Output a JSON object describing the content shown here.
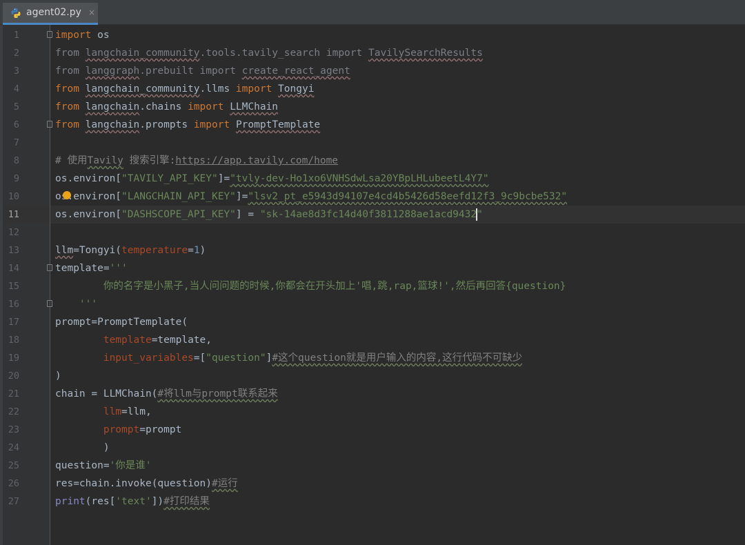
{
  "tab": {
    "filename": "agent02.py",
    "close_glyph": "×"
  },
  "editor": {
    "current_line": 11,
    "lines": [
      {
        "n": "1"
      },
      {
        "n": "2"
      },
      {
        "n": "3"
      },
      {
        "n": "4"
      },
      {
        "n": "5"
      },
      {
        "n": "6"
      },
      {
        "n": "7"
      },
      {
        "n": "8"
      },
      {
        "n": "9"
      },
      {
        "n": "10"
      },
      {
        "n": "11"
      },
      {
        "n": "12"
      },
      {
        "n": "13"
      },
      {
        "n": "14"
      },
      {
        "n": "15"
      },
      {
        "n": "16"
      },
      {
        "n": "17"
      },
      {
        "n": "18"
      },
      {
        "n": "19"
      },
      {
        "n": "20"
      },
      {
        "n": "21"
      },
      {
        "n": "22"
      },
      {
        "n": "23"
      },
      {
        "n": "24"
      },
      {
        "n": "25"
      },
      {
        "n": "26"
      },
      {
        "n": "27"
      }
    ],
    "code": {
      "l1": {
        "kw": "import",
        "rest": " os"
      },
      "l2": {
        "kw1": "from",
        "mod": "langchain_community",
        "mid": ".tools.tavily_search ",
        "kw2": "import",
        "name": "TavilySearchResults"
      },
      "l3": {
        "kw1": "from",
        "mod": "langgraph",
        "mid": ".prebuilt ",
        "kw2": "import",
        "name": "create_react_agent"
      },
      "l4": {
        "kw1": "from",
        "mod": "langchain_community",
        "mid": ".llms ",
        "kw2": "import",
        "name": "Tongyi"
      },
      "l5": {
        "kw1": "from",
        "mod": "langchain",
        "mid": ".chains ",
        "kw2": "import",
        "name": "LLMChain"
      },
      "l6": {
        "kw1": "from",
        "mod": "langchain",
        "mid": ".prompts ",
        "kw2": "import",
        "name": "PromptTemplate"
      },
      "l8": {
        "prefix": "# 使用",
        "tav": "Tavily",
        "mid": " 搜索引擎:",
        "url": "https://app.tavily.com/home"
      },
      "l9": {
        "head": "os.environ[",
        "key": "\"TAVILY_API_KEY\"",
        "eq": "]=",
        "val": "\"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\""
      },
      "l10": {
        "head": "os.environ[",
        "key": "\"LANGCHAIN_API_KEY\"",
        "eq": "]=",
        "val": "\"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\""
      },
      "l11": {
        "head": "os.environ[",
        "key": "\"DASHSCOPE_API_KEY\"",
        "eq": "] = ",
        "val_a": "\"sk-14ae8d3fc14d40f3811288ae1acd9432",
        "val_b": "\""
      },
      "l13": {
        "a": "llm",
        "b": "=Tongyi(",
        "param": "temperature",
        "c": "=",
        "num": "1",
        "d": ")"
      },
      "l14": {
        "a": "template",
        "b": "=",
        "str": "'''"
      },
      "l15": {
        "str": "        你的名字是小黑子,当人问问题的时候,你都会在开头加上'唱,跳,rap,篮球!',然后再回答{question}"
      },
      "l16": {
        "str": "    '''"
      },
      "l17": {
        "a": "prompt",
        "b": "=PromptTemplate("
      },
      "l18": {
        "indent": "        ",
        "param": "template",
        "b": "=template,"
      },
      "l19": {
        "indent": "        ",
        "param": "input_variables",
        "b": "=[",
        "str": "\"question\"",
        "c": "]",
        "cmt": "#这个question就是用户输入的内容,这行代码不可缺少"
      },
      "l20": {
        "a": ")"
      },
      "l21": {
        "a": "chain = LLMChain(",
        "cmt": "#将llm与prompt联系起来"
      },
      "l22": {
        "indent": "        ",
        "param": "llm",
        "b": "=llm,"
      },
      "l23": {
        "indent": "        ",
        "param": "prompt",
        "b": "=prompt"
      },
      "l24": {
        "a": "        )"
      },
      "l25": {
        "a": "question",
        "b": "=",
        "str": "'你是谁'"
      },
      "l26": {
        "a": "res",
        "b": "=chain.invoke(question)",
        "cmt": "#运行"
      },
      "l27": {
        "fn": "print",
        "b": "(res[",
        "str": "'text'",
        "c": "])",
        "cmt": "#打印结果"
      }
    }
  },
  "colors": {
    "background": "#2b2b2b",
    "gutter": "#313335",
    "keyword": "#cc7832",
    "string": "#6a8759",
    "number": "#6897bb",
    "param": "#aa4926",
    "comment": "#808080",
    "builtin": "#8888c6",
    "tab_accent": "#4a88c7",
    "intention_bulb": "#e8a317"
  },
  "icons": {
    "tab_icon": "python-file-icon",
    "bulb": "intention-bulb-icon"
  }
}
